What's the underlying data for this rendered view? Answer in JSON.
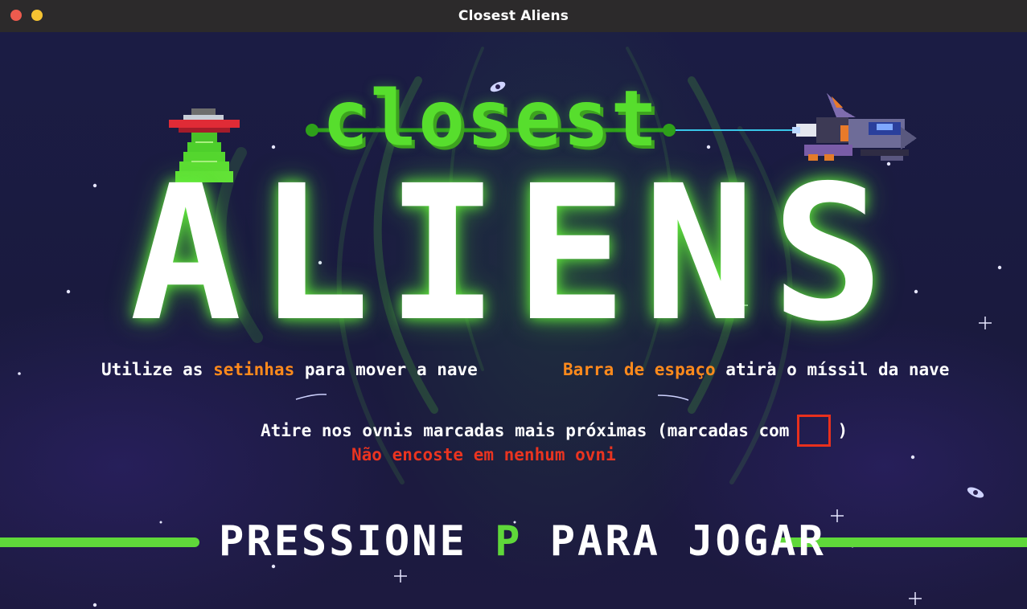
{
  "window": {
    "title": "Closest Aliens"
  },
  "title": {
    "closest": "closest",
    "aliens": "ALIENS"
  },
  "hints": {
    "left": {
      "before": "Utilize as ",
      "highlight": "setinhas",
      "after": " para mover a nave"
    },
    "right": {
      "highlight": "Barra de espaço",
      "after": " atira o míssil da nave"
    }
  },
  "instruction": {
    "before": "Atire nos ovnis marcadas mais próximas (marcadas com",
    "after": ")"
  },
  "warning": "Não encoste em nenhum ovni",
  "prompt": {
    "before": "PRESSIONE ",
    "key": "P",
    "after": " PARA JOGAR"
  },
  "colors": {
    "title_green": "#57de2d",
    "highlight_orange": "#ff8a1c",
    "warning_red": "#ea3420",
    "accent_green": "#5fd83a",
    "marker_red": "#e8301d",
    "background": "#1b1a3d"
  },
  "icons": [
    "ufo-icon",
    "spaceship-icon",
    "laser-beam-icon",
    "marker-box-icon"
  ]
}
